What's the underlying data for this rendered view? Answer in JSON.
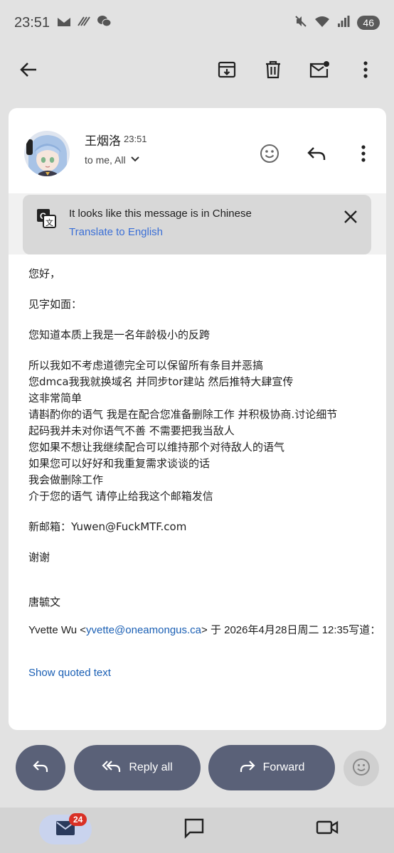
{
  "status_bar": {
    "time": "23:51",
    "battery": "46"
  },
  "email": {
    "sender_name": "王烟洛",
    "time": "23:51",
    "recipients": "to me, All"
  },
  "translate_banner": {
    "message": "It looks like this message is in Chinese",
    "link": "Translate to English"
  },
  "body": {
    "greeting": "您好，",
    "line_intro": "见字如面：",
    "para1": "您知道本质上我是一名年龄极小的反跨",
    "para2_lines": [
      "所以我如不考虑道德完全可以保留所有条目并恶搞",
      "您dmca我我就换域名 并同步tor建站 然后推特大肆宣传",
      "这非常简单",
      "请斟酌你的语气 我是在配合您准备删除工作 并积极协商.讨论细节",
      "起码我并未对你语气不善 不需要把我当敌人",
      "您如果不想让我继续配合可以维持那个对待敌人的语气",
      "如果您可以好好和我重复需求谈谈的话",
      "我会做删除工作",
      "介于您的语气 请停止给我这个邮箱发信"
    ],
    "new_email": "新邮箱：Yuwen@FuckMTF.com",
    "thanks": "谢谢",
    "signature": "唐毓文"
  },
  "quote": {
    "prefix": "Yvette Wu <",
    "email": "yvette@oneamongus.ca",
    "suffix": "> 于 2026年4月28日周二 12:35写道："
  },
  "show_quoted": "Show quoted text",
  "actions": {
    "reply_all": "Reply all",
    "forward": "Forward"
  },
  "bottom_nav": {
    "mail_badge": "24"
  }
}
